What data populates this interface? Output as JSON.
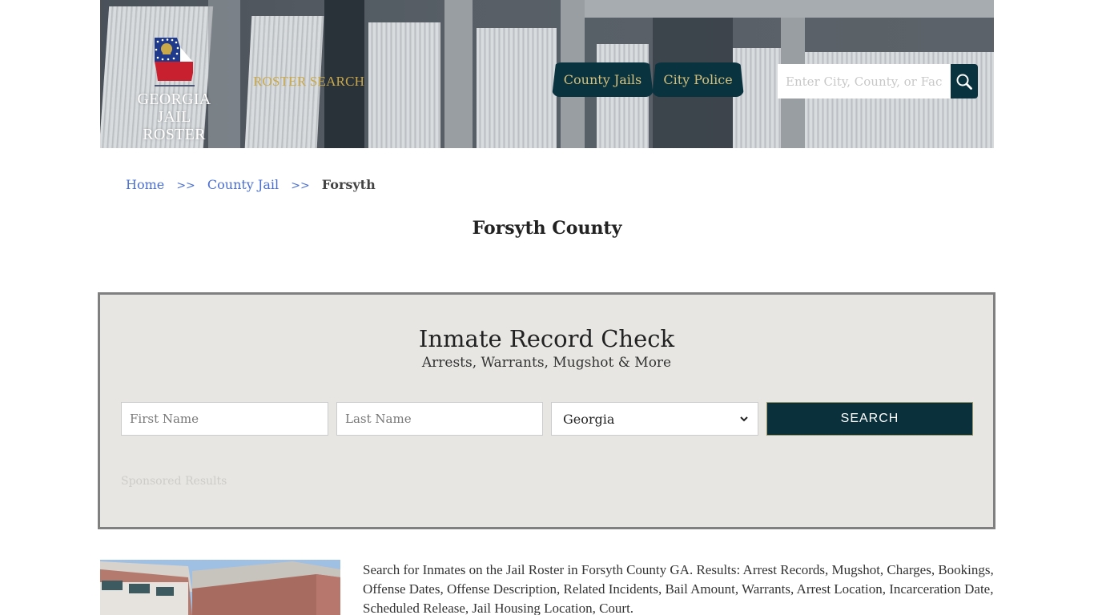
{
  "header": {
    "logo": {
      "line1": "GEORGIA",
      "line2": "JAIL ROSTER",
      "icon": "georgia-flag-map-icon"
    },
    "roster_search_label": "ROSTER SEARCH",
    "nav": [
      {
        "label": "County Jails"
      },
      {
        "label": "City Police"
      }
    ],
    "search": {
      "placeholder": "Enter City, County, or Facility",
      "value": "",
      "icon": "search-icon"
    }
  },
  "breadcrumb": {
    "items": [
      {
        "label": "Home"
      },
      {
        "label": "County Jail"
      }
    ],
    "separator": ">>",
    "current": "Forsyth"
  },
  "page_title": "Forsyth County",
  "record_check": {
    "title": "Inmate Record Check",
    "subtitle": "Arrests, Warrants, Mugshot & More",
    "first_name_placeholder": "First Name",
    "last_name_placeholder": "Last Name",
    "state_selected": "Georgia",
    "search_label": "SEARCH",
    "sponsored_label": "Sponsored Results"
  },
  "intro": {
    "text": "Search for Inmates on the Jail Roster in Forsyth County GA. Results: Arrest Records, Mugshot, Charges, Bookings, Offense Dates, Offense Description, Related Incidents, Bail Amount, Warrants, Arrest Location, Incarceration Date, Scheduled Release, Jail Housing Location, Court."
  },
  "colors": {
    "brand_dark": "#0a3340",
    "brand_gold": "#d4c07a",
    "link_blue": "#4a6fd1",
    "panel_bg": "#e7e6e2"
  }
}
